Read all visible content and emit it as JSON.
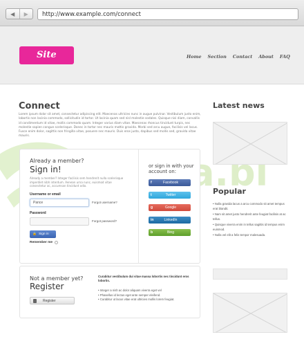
{
  "browser": {
    "back_icon": "◀",
    "forward_icon": "▶",
    "url": "http://www.example.com/connect"
  },
  "header": {
    "logo": "Site",
    "nav": [
      "Home",
      "Section",
      "Contact",
      "About",
      "FAQ"
    ]
  },
  "main": {
    "title": "Connect",
    "intro": "Lorem ipsum dolor sit amet, consectetur adipiscing elit. Maecenas ultricies nunc in augue pulvinar. Vestibulum justo enim, lobortis non lacinia commodo, sollicitudin id tortor. Ut lacinia quam sed nisl molestie sodales. Quisque nisi diam, convallis id condimentum id vitae, mollis commodo quam. Integer varius diam vitae. Maecenas rhoncus tincidunt turpis, nec molestie sapien congue scelerisque. Donec in tortor nec mauris mattis gravida. Morbi sed arcu augue, facilisis vel lacus. Fusce enim dolor, sagittis non fringilla vitae, posuere nec mauris. Duis eros justo, dapibus sed mollis sed, gravida vitae mauris.",
    "login": {
      "already": "Already a member?",
      "signin_title": "Sign in!",
      "note": "Already a member? Integer facilisis sem hendrerit nulla scelerisque imperdiet nibh interdum. Aenean urna nunc, euismod vitae consectetur ac, accumsan tincidunt odio.",
      "username_label": "Username or email",
      "username_value": "Pance",
      "forgot_username": "Forgot username?",
      "password_label": "Password",
      "forgot_password": "Forgot password?",
      "signin_button": "Sign in",
      "remember": "Remember me"
    },
    "social": {
      "title": "or sign in with your account on:",
      "buttons": [
        {
          "icon": "f",
          "label": "Facebook"
        },
        {
          "icon": "t",
          "label": "Twitter"
        },
        {
          "icon": "g",
          "label": "Google"
        },
        {
          "icon": "in",
          "label": "LinkedIn"
        },
        {
          "icon": "b",
          "label": "Bing"
        }
      ]
    },
    "register": {
      "not_member": "Not a member yet?",
      "title": "Register",
      "button": "Register",
      "benefits_title": "Curabitur vestibulum dui vitae massa lobortis nec tincidunt eros lobortis.",
      "benefits": [
        "Integer a nish ac dolor aliquam viverra eget vel",
        "Phasellus id lectus eget ante semper eleifend.",
        "Curabitur ut lacus vitae erat ultricies mollis lorem feugiat."
      ]
    }
  },
  "sidebar": {
    "news_title": "Latest news",
    "popular_title": "Popular",
    "popular": [
      "Nulla gravida lacus a arcu commodo sit amet tempus erat blandit.",
      "Nam sit amet justo hendrerit ante feugiat facilisis at ac tellus.",
      "Quisque viverra enim in tellus sagittis id tempus enim euismod.",
      "Nulla vel elit a felis tempor malesuada."
    ]
  },
  "watermark": "Joomla.bi",
  "colors": {
    "brand": "#e8279a",
    "facebook": "#3b5998",
    "twitter": "#2fa7dc",
    "google": "#d04a3c",
    "linkedin": "#1c6aa2",
    "bing": "#5e9f2b"
  }
}
